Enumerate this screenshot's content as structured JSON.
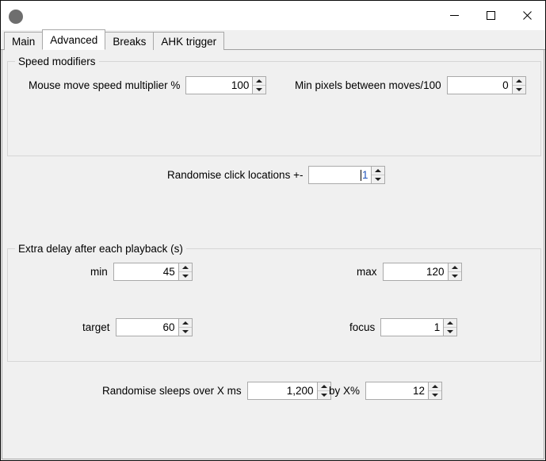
{
  "window": {
    "title": "",
    "icon": "app-circle-icon",
    "controls": {
      "minimize": "minimize-icon",
      "maximize": "maximize-icon",
      "close": "close-icon"
    }
  },
  "tabs": [
    {
      "label": "Main",
      "selected": false
    },
    {
      "label": "Advanced",
      "selected": true
    },
    {
      "label": "Breaks",
      "selected": false
    },
    {
      "label": "AHK trigger",
      "selected": false
    }
  ],
  "groups": {
    "speed_modifiers": {
      "legend": "Speed modifiers"
    },
    "extra_delay": {
      "legend": "Extra delay after each playback (s)"
    }
  },
  "fields": {
    "mouse_move_speed_multiplier": {
      "label": "Mouse move speed multiplier %",
      "value": "100"
    },
    "min_pixels_between_moves": {
      "label": "Min pixels between moves/100",
      "value": "0"
    },
    "randomise_click_locations": {
      "label": "Randomise click locations +-",
      "value": "1",
      "focused": true
    },
    "min_delay": {
      "label": "min",
      "value": "45"
    },
    "max_delay": {
      "label": "max",
      "value": "120"
    },
    "target_delay": {
      "label": "target",
      "value": "60"
    },
    "focus_delay": {
      "label": "focus",
      "value": "1"
    },
    "randomise_sleeps_over": {
      "label": "Randomise sleeps over X ms",
      "value": "1,200"
    },
    "randomise_sleeps_by": {
      "label": "by X%",
      "value": "12"
    }
  },
  "colors": {
    "window_bg": "#f0f0f0",
    "titlebar_bg": "#ffffff",
    "field_bg": "#ffffff",
    "border": "#a8a8a8",
    "group_border": "#d6d6d6",
    "text": "#000000",
    "focus_text": "#2255bb"
  }
}
